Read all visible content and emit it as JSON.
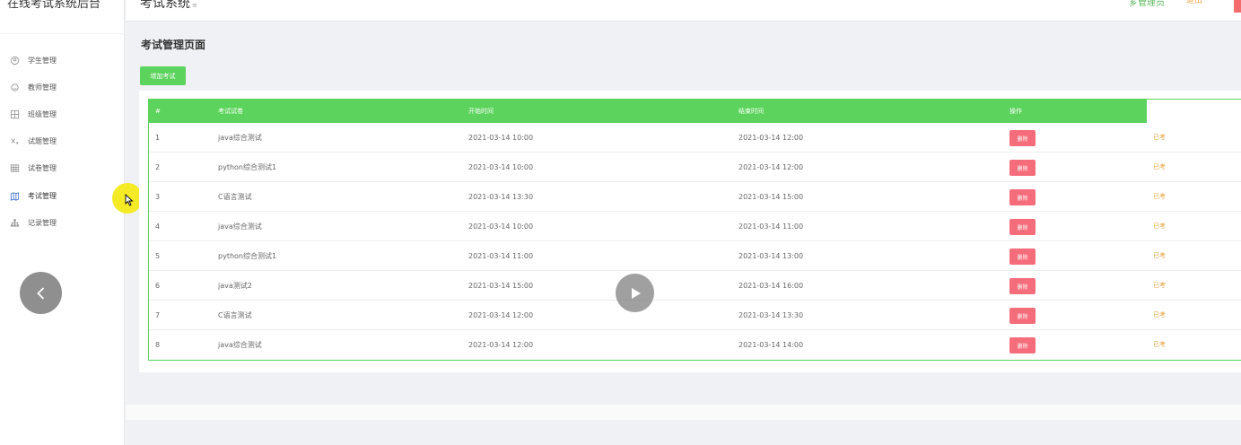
{
  "app": {
    "brand": "在线考试系统后台"
  },
  "header": {
    "title": "考试系统",
    "title_mark": "≡",
    "admin_label": "芗管理员",
    "logout_label": "退出",
    "accent": "#5cb85c"
  },
  "sidebar": {
    "items": [
      {
        "label": "学生管理",
        "icon": "user-circle-icon"
      },
      {
        "label": "教师管理",
        "icon": "teacher-icon"
      },
      {
        "label": "班级管理",
        "icon": "grid-icon"
      },
      {
        "label": "试题管理",
        "icon": "question-icon"
      },
      {
        "label": "试卷管理",
        "icon": "table-icon"
      },
      {
        "label": "考试管理",
        "icon": "map-icon"
      },
      {
        "label": "记录管理",
        "icon": "sitemap-icon"
      }
    ],
    "active_index": 5
  },
  "main": {
    "section_title": "考试管理页面",
    "add_button": "增加考试"
  },
  "table": {
    "header_color": "#5cd35c",
    "columns": [
      "#",
      "考试试卷",
      "开始时间",
      "结束时间",
      "操作"
    ],
    "delete_label": "删除",
    "delete_color": "#f56c7a",
    "status_color": "#e6a23c",
    "rows": [
      {
        "id": "1",
        "paper": "java综合测试",
        "start": "2021-03-14 10:00",
        "end": "2021-03-14 12:00",
        "status": "已考"
      },
      {
        "id": "2",
        "paper": "python综合测试1",
        "start": "2021-03-14 10:00",
        "end": "2021-03-14 12:00",
        "status": "已考"
      },
      {
        "id": "3",
        "paper": "C语言测试",
        "start": "2021-03-14 13:30",
        "end": "2021-03-14 15:00",
        "status": "已考"
      },
      {
        "id": "4",
        "paper": "java综合测试",
        "start": "2021-03-14 10:00",
        "end": "2021-03-14 11:00",
        "status": "已考"
      },
      {
        "id": "5",
        "paper": "python综合测试1",
        "start": "2021-03-14 11:00",
        "end": "2021-03-14 13:00",
        "status": "已考"
      },
      {
        "id": "6",
        "paper": "java测试2",
        "start": "2021-03-14 15:00",
        "end": "2021-03-14 16:00",
        "status": "已考"
      },
      {
        "id": "7",
        "paper": "C语言测试",
        "start": "2021-03-14 12:00",
        "end": "2021-03-14 13:30",
        "status": "已考"
      },
      {
        "id": "8",
        "paper": "java综合测试",
        "start": "2021-03-14 12:00",
        "end": "2021-03-14 14:00",
        "status": "已考"
      }
    ]
  }
}
